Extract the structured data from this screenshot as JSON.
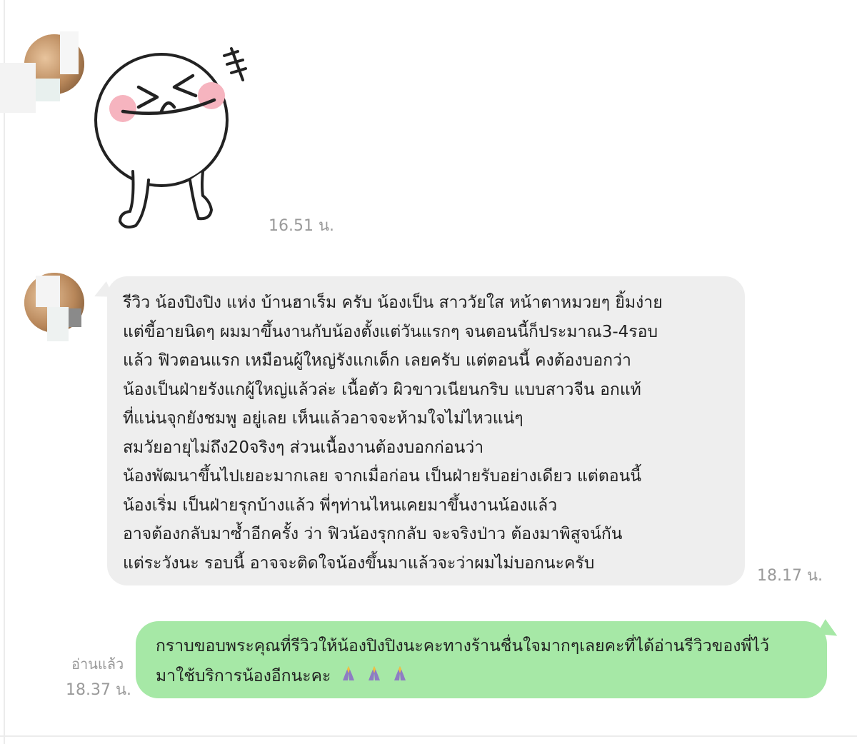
{
  "chat": {
    "sticker": {
      "icon": "laughing-face-sticker-icon"
    },
    "sticker_time": "16.51 น.",
    "review_time": "18.17 น.",
    "review_lines": [
      "รีวิว น้องปิงปิง แห่ง บ้านฮาเร็ม ครับ น้องเป็น สาววัยใส หน้าตาหมวยๆ ยิ้มง่าย",
      "แต่ขี้อายนิดๆ ผมมาขึ้นงานกับน้องตั้งแต่วันแรกๆ จนตอนนี้ก็ประมาณ3-4รอบ",
      "แล้ว ฟิวตอนแรก เหมือนผู้ใหญ่รังแกเด็ก เลยครับ แต่ตอนนี้ คงต้องบอกว่า",
      "น้องเป็นฝ่ายรังแกผู้ใหญ่แล้วล่ะ เนื้อตัว ผิวขาวเนียนกริบ แบบสาวจีน อกแท้",
      "ที่แน่นจุกยังชมพู อยู่เลย เห็นแล้วอาจจะห้ามใจไม่ไหวแน่ๆ",
      "สมวัยอายุไม่ถึง20จริงๆ ส่วนเนื้องานต้องบอกก่อนว่า",
      "น้องพัฒนาขึ้นไปเยอะมากเลย จากเมื่อก่อน เป็นฝ่ายรับอย่างเดียว แต่ตอนนี้",
      "น้องเริ่ม เป็นฝ่ายรุกบ้างแล้ว พี่ๆท่านไหนเคยมาขึ้นงานน้องแล้ว",
      "อาจต้องกลับมาซ้ำอีกครั้ง ว่า ฟิวน้องรุกกลับ จะจริงป่าว ต้องมาพิสูจน์กัน",
      "แต่ระวังนะ รอบนี้ อาจจะติดใจน้องขึ้นมาแล้วจะว่าผมไม่บอกนะครับ"
    ],
    "reply_lines": [
      "กราบขอบพระคุณที่รีวิวให้น้องปิงปิงนะคะทางร้านชื่นใจมากๆเลยคะที่ได้อ่านรีวิวของพี่ไว้",
      "มาใช้บริการน้องอีกนะคะ"
    ],
    "reply_emoji": [
      "🙏",
      "🙏",
      "🙏"
    ],
    "read_label": "อ่านแล้ว",
    "reply_time": "18.37 น."
  },
  "colors": {
    "incoming_bubble": "#eeeeee",
    "outgoing_bubble": "#a6e8a6",
    "timestamp": "#9a9a9a",
    "text": "#1f1f1f"
  }
}
